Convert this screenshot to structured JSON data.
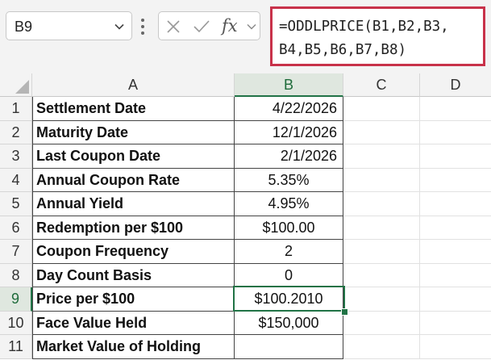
{
  "name_box": {
    "value": "B9"
  },
  "formula_bar": {
    "line1": "=ODDLPRICE(B1,B2,B3,",
    "line2": "B4,B5,B6,B7,B8)",
    "fx_label": "fx"
  },
  "columns": [
    "A",
    "B",
    "C",
    "D"
  ],
  "selected_column": "B",
  "selected_row": 9,
  "rows": [
    {
      "num": "1",
      "label": "Settlement Date",
      "value": "4/22/2026",
      "align": "right"
    },
    {
      "num": "2",
      "label": "Maturity Date",
      "value": "12/1/2026",
      "align": "right"
    },
    {
      "num": "3",
      "label": "Last Coupon Date",
      "value": "2/1/2026",
      "align": "right"
    },
    {
      "num": "4",
      "label": "Annual Coupon Rate",
      "value": "5.35%",
      "align": "center"
    },
    {
      "num": "5",
      "label": "Annual Yield",
      "value": "4.95%",
      "align": "center"
    },
    {
      "num": "6",
      "label": "Redemption per $100",
      "value": "$100.00",
      "align": "center"
    },
    {
      "num": "7",
      "label": "Coupon Frequency",
      "value": "2",
      "align": "center"
    },
    {
      "num": "8",
      "label": "Day Count Basis",
      "value": "0",
      "align": "center"
    },
    {
      "num": "9",
      "label": "Price per $100",
      "value": "$100.2010",
      "align": "center"
    },
    {
      "num": "10",
      "label": "Face Value Held",
      "value": "$150,000",
      "align": "center"
    },
    {
      "num": "11",
      "label": "Market Value of Holding",
      "value": "",
      "align": "center"
    }
  ],
  "colors": {
    "accent": "#217346",
    "formula_highlight": "#c8324a"
  },
  "icons": [
    "chevron-down-icon",
    "more-vertical-icon",
    "cancel-x-icon",
    "enter-check-icon",
    "function-fx-icon"
  ]
}
